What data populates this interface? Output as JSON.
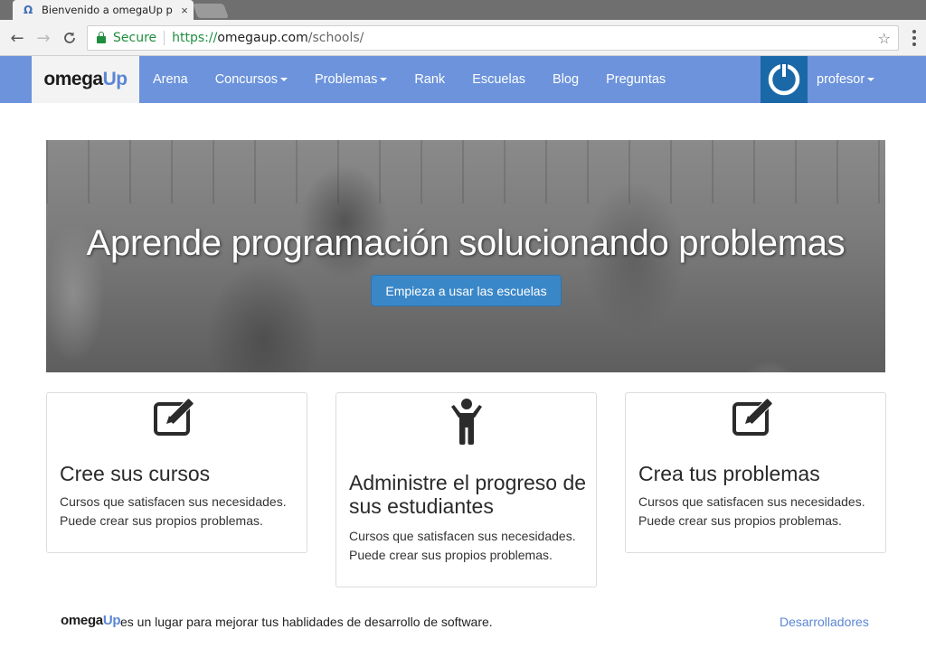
{
  "browser": {
    "tab_title": "Bienvenido a omegaUp p",
    "tab_favicon": "Ω",
    "security_label": "Secure",
    "url_scheme": "https://",
    "url_host": "omegaup.com",
    "url_path": "/schools/"
  },
  "nav": {
    "brand_omega": "omega",
    "brand_up": "Up",
    "items": [
      {
        "label": "Arena",
        "dropdown": false
      },
      {
        "label": "Concursos",
        "dropdown": true
      },
      {
        "label": "Problemas",
        "dropdown": true
      },
      {
        "label": "Rank",
        "dropdown": false
      },
      {
        "label": "Escuelas",
        "dropdown": false
      },
      {
        "label": "Blog",
        "dropdown": false
      },
      {
        "label": "Preguntas",
        "dropdown": false
      }
    ],
    "user": "profesor"
  },
  "hero": {
    "title": "Aprende programación solucionando problemas",
    "button": "Empieza a usar las escuelas"
  },
  "cards": [
    {
      "icon": "edit-icon",
      "title": "Cree sus cursos",
      "line1": "Cursos que satisfacen sus necesidades.",
      "line2": "Puede crear sus propios problemas."
    },
    {
      "icon": "student-icon",
      "title": "Administre el progreso de sus estudiantes",
      "line1": "Cursos que satisfacen sus necesidades.",
      "line2": "Puede crear sus propios problemas."
    },
    {
      "icon": "edit-icon",
      "title": "Crea tus problemas",
      "line1": "Cursos que satisfacen sus necesidades.",
      "line2": "Puede crear sus propios problemas."
    }
  ],
  "footer": {
    "brand_omega": "omega",
    "brand_up": "Up",
    "text": "es un lugar para mejorar tus hablidades de desarrollo de software.",
    "link": "Desarrolladores"
  },
  "colors": {
    "navbar": "#6c93dc",
    "brand_accent": "#5b86d4",
    "primary_button": "#3a87c8"
  }
}
